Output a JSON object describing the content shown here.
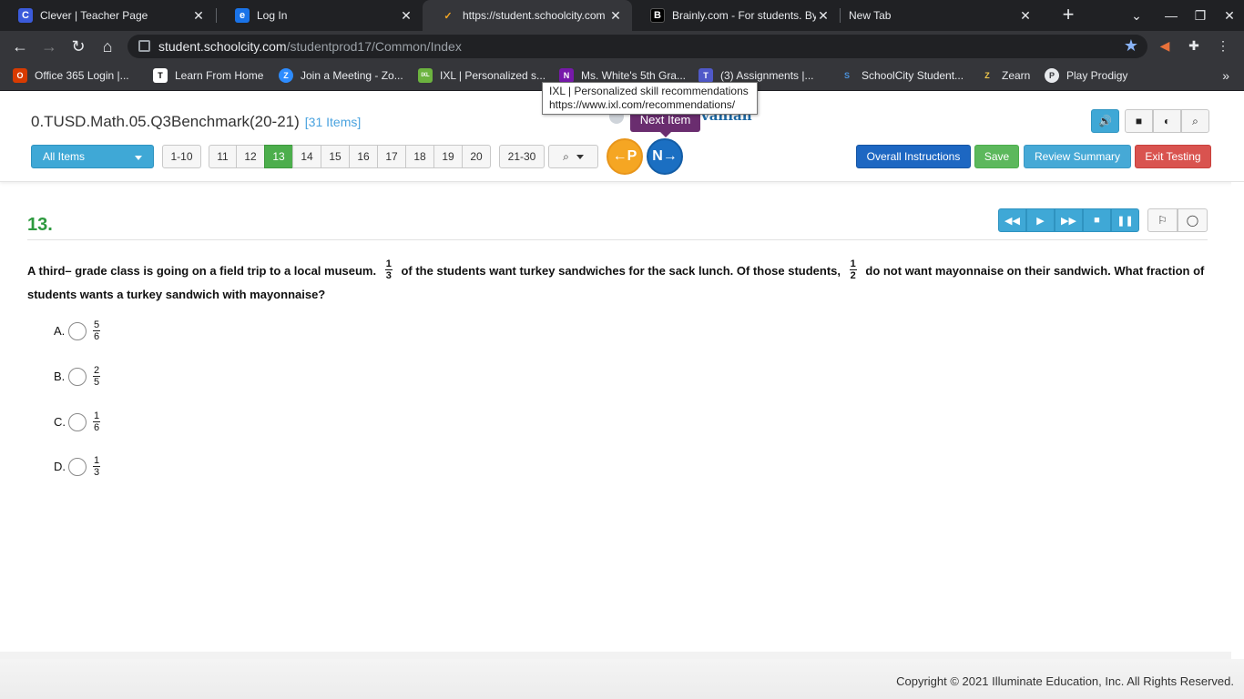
{
  "browser": {
    "tabs": [
      {
        "label": "Clever | Teacher Page",
        "favicon": "C",
        "color": "#3b5bdb"
      },
      {
        "label": "Log In",
        "favicon": "e",
        "color": "#1a73e8"
      },
      {
        "label": "https://student.schoolcity.com",
        "favicon": "✓",
        "color": "#35363a"
      },
      {
        "label": "Brainly.com - For students. By",
        "favicon": "B",
        "color": "#000000"
      },
      {
        "label": "New Tab",
        "favicon": "",
        "color": "#202124"
      }
    ],
    "url_host": "student.schoolcity.com",
    "url_path": "/studentprod17/Common/Index",
    "bookmarks": [
      {
        "label": "Office 365 Login |...",
        "favicon": "O",
        "color": "#d83b01"
      },
      {
        "label": "Learn From Home",
        "favicon": "T",
        "color": "#000000"
      },
      {
        "label": "Join a Meeting - Zo...",
        "favicon": "Z",
        "color": "#2d8cff"
      },
      {
        "label": "IXL | Personalized s...",
        "favicon": "IXL",
        "color": "#6cb33f"
      },
      {
        "label": "Ms. White's 5th Gra...",
        "favicon": "N",
        "color": "#7719aa"
      },
      {
        "label": "(3) Assignments |...",
        "favicon": "T",
        "color": "#5059c9"
      },
      {
        "label": "SchoolCity Student...",
        "favicon": "S",
        "color": "#4a90d9"
      },
      {
        "label": "Zearn",
        "favicon": "Z",
        "color": "#f2c94c"
      },
      {
        "label": "Play Prodigy",
        "favicon": "P",
        "color": "#9aa0a6"
      }
    ],
    "tooltip_line1": "IXL | Personalized skill recommendations",
    "tooltip_line2": "https://www.ixl.com/recommendations/"
  },
  "header": {
    "title": "0.TUSD.Math.05.Q3Benchmark(20-21)",
    "item_count": "[31 Items]",
    "brand_fragment": "vanian",
    "next_tooltip": "Next Item",
    "all_items_label": "All Items",
    "range_prev": "1-10",
    "pages": [
      "11",
      "12",
      "13",
      "14",
      "15",
      "16",
      "17",
      "18",
      "19",
      "20"
    ],
    "active_page": "13",
    "range_next": "21-30",
    "prev_label": "P",
    "next_label": "N",
    "buttons": {
      "instructions": "Overall Instructions",
      "save": "Save",
      "review": "Review Summary",
      "exit": "Exit Testing"
    }
  },
  "question": {
    "number": "13.",
    "stem_part1": "A third– grade class is going on a field trip to a local museum.",
    "frac1_num": "1",
    "frac1_den": "3",
    "stem_part2": "of the students want turkey sandwiches for the sack lunch.  Of those students,",
    "frac2_num": "1",
    "frac2_den": "2",
    "stem_part3": "do not want mayonnaise on their sandwich.  What fraction of students wants a turkey sandwich with mayonnaise?",
    "choices": [
      {
        "letter": "A.",
        "num": "5",
        "den": "6"
      },
      {
        "letter": "B.",
        "num": "2",
        "den": "5"
      },
      {
        "letter": "C.",
        "num": "1",
        "den": "6"
      },
      {
        "letter": "D.",
        "num": "1",
        "den": "3"
      }
    ]
  },
  "footer": {
    "copyright": "Copyright © 2021 Illuminate Education, Inc. All Rights Reserved."
  },
  "colors": {
    "accent_green": "#4cae4c",
    "accent_blue": "#3fa8d6",
    "exit_red": "#d9534f"
  }
}
